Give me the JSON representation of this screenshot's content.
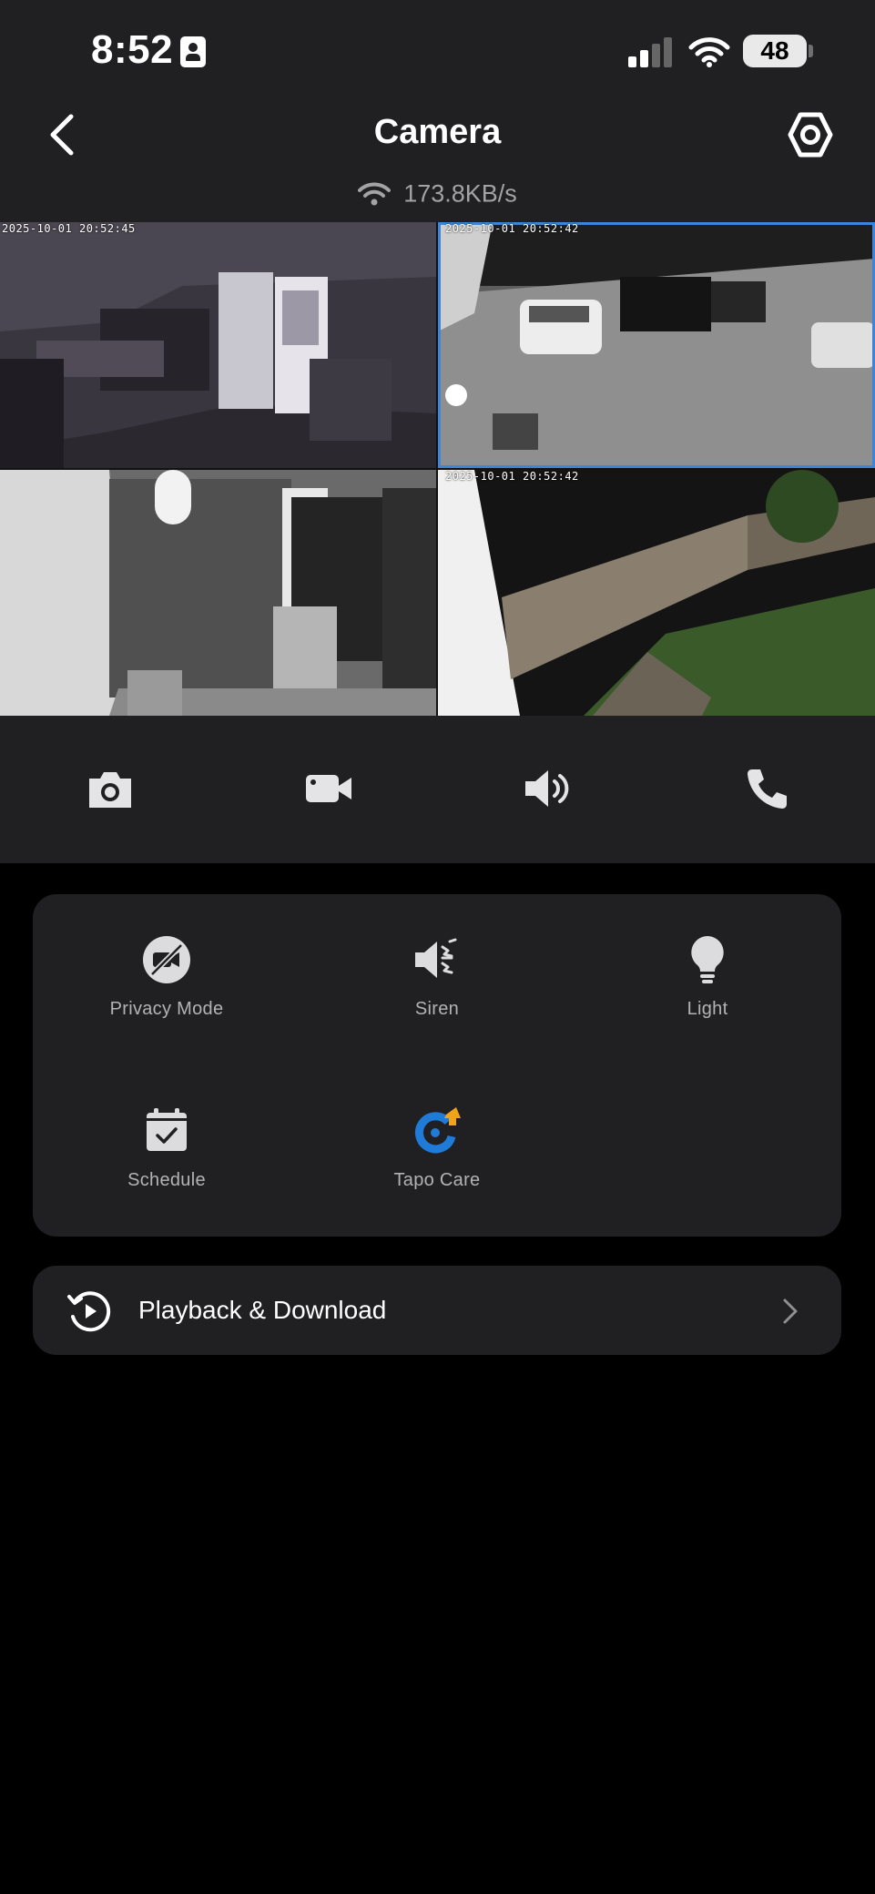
{
  "status_bar": {
    "time": "8:52",
    "battery": "48"
  },
  "nav": {
    "title": "Camera"
  },
  "stream": {
    "speed": "173.8KB/s"
  },
  "cameras": [
    {
      "timestamp": "2025-10-01 20:52:45"
    },
    {
      "timestamp": "2025-10-01 20:52:42"
    },
    {
      "timestamp": ""
    },
    {
      "timestamp": "2025-10-01 20:52:42"
    }
  ],
  "controls": [
    {
      "icon": "snapshot-camera-icon"
    },
    {
      "icon": "record-video-icon"
    },
    {
      "icon": "speaker-icon"
    },
    {
      "icon": "phone-call-icon"
    }
  ],
  "features": [
    {
      "label": "Privacy Mode",
      "icon": "privacy-mode-icon"
    },
    {
      "label": "Siren",
      "icon": "siren-icon"
    },
    {
      "label": "Light",
      "icon": "light-bulb-icon"
    },
    {
      "label": "Schedule",
      "icon": "calendar-check-icon"
    },
    {
      "label": "Tapo Care",
      "icon": "tapo-care-icon"
    }
  ],
  "playback": {
    "label": "Playback & Download"
  },
  "colors": {
    "panel": "#202022",
    "background": "#000000",
    "selected_border": "#3a86d9",
    "tapo_blue": "#1f7ad8",
    "tapo_orange": "#f2a418"
  }
}
